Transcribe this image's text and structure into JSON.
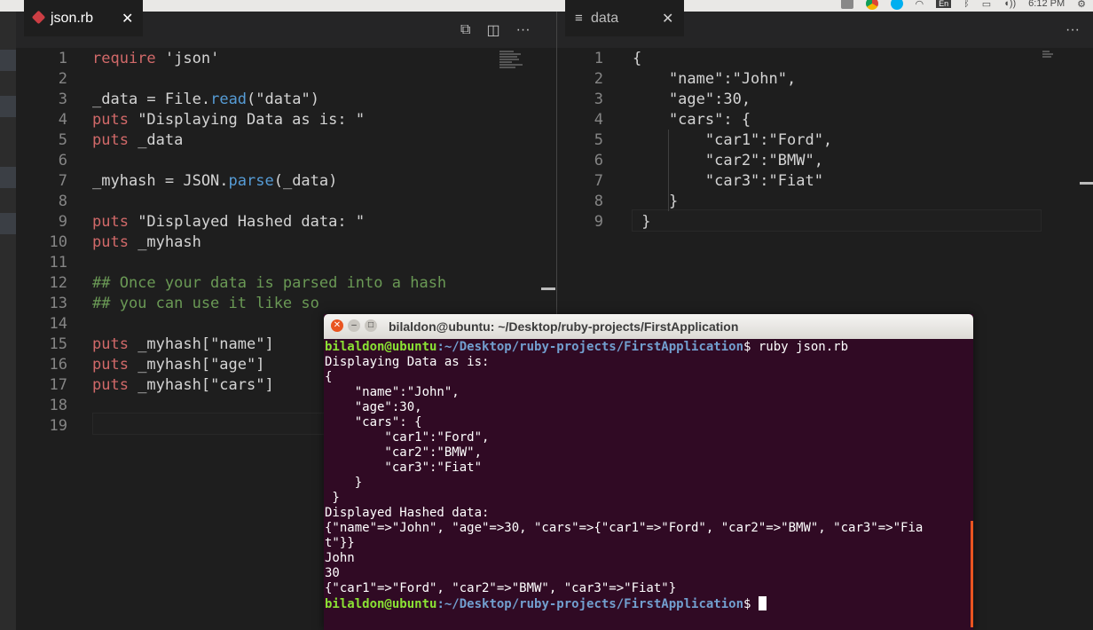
{
  "system_tray": {
    "keyboard_layout": "En",
    "clock": "6:12 PM",
    "icons": [
      "gamepad-icon",
      "chrome-icon",
      "skype-icon",
      "wifi-icon",
      "bluetooth-icon",
      "battery-icon",
      "volume-icon",
      "gear-icon"
    ]
  },
  "left_editor": {
    "tab": {
      "filename": "json.rb",
      "close": "✕"
    },
    "actions": {
      "open_preview": "⧉",
      "split": "◫",
      "more": "···"
    },
    "lines": [
      {
        "n": "1",
        "segments": [
          {
            "t": "require ",
            "c": "kw"
          },
          {
            "t": "'json'",
            "c": "str"
          }
        ]
      },
      {
        "n": "2",
        "segments": []
      },
      {
        "n": "3",
        "segments": [
          {
            "t": "_data = ",
            "c": ""
          },
          {
            "t": "File",
            "c": ""
          },
          {
            "t": ".",
            "c": ""
          },
          {
            "t": "read",
            "c": "meth"
          },
          {
            "t": "(\"data\")",
            "c": ""
          }
        ]
      },
      {
        "n": "4",
        "segments": [
          {
            "t": "puts ",
            "c": "kw"
          },
          {
            "t": "\"Displaying Data as is: \"",
            "c": "str"
          }
        ]
      },
      {
        "n": "5",
        "segments": [
          {
            "t": "puts ",
            "c": "kw"
          },
          {
            "t": "_data",
            "c": ""
          }
        ]
      },
      {
        "n": "6",
        "segments": []
      },
      {
        "n": "7",
        "segments": [
          {
            "t": "_myhash = JSON.",
            "c": ""
          },
          {
            "t": "parse",
            "c": "meth"
          },
          {
            "t": "(_data)",
            "c": ""
          }
        ]
      },
      {
        "n": "8",
        "segments": []
      },
      {
        "n": "9",
        "segments": [
          {
            "t": "puts ",
            "c": "kw"
          },
          {
            "t": "\"Displayed Hashed data: \"",
            "c": "str"
          }
        ]
      },
      {
        "n": "10",
        "segments": [
          {
            "t": "puts ",
            "c": "kw"
          },
          {
            "t": "_myhash",
            "c": ""
          }
        ]
      },
      {
        "n": "11",
        "segments": []
      },
      {
        "n": "12",
        "segments": [
          {
            "t": "## Once your data is parsed into a hash",
            "c": "cmt"
          }
        ]
      },
      {
        "n": "13",
        "segments": [
          {
            "t": "## you can use it like so",
            "c": "cmt"
          }
        ]
      },
      {
        "n": "14",
        "segments": []
      },
      {
        "n": "15",
        "segments": [
          {
            "t": "puts ",
            "c": "kw"
          },
          {
            "t": "_myhash[\"name\"]",
            "c": ""
          }
        ]
      },
      {
        "n": "16",
        "segments": [
          {
            "t": "puts ",
            "c": "kw"
          },
          {
            "t": "_myhash[\"age\"]",
            "c": ""
          }
        ]
      },
      {
        "n": "17",
        "segments": [
          {
            "t": "puts ",
            "c": "kw"
          },
          {
            "t": "_myhash[\"cars\"]",
            "c": ""
          }
        ]
      },
      {
        "n": "18",
        "segments": []
      },
      {
        "n": "19",
        "segments": []
      }
    ]
  },
  "right_editor": {
    "tab": {
      "filename": "data",
      "close": "✕"
    },
    "actions": {
      "more": "···"
    },
    "lines": [
      {
        "n": "1",
        "text": "{"
      },
      {
        "n": "2",
        "text": "    \"name\":\"John\","
      },
      {
        "n": "3",
        "text": "    \"age\":30,"
      },
      {
        "n": "4",
        "text": "    \"cars\": {"
      },
      {
        "n": "5",
        "text": "        \"car1\":\"Ford\","
      },
      {
        "n": "6",
        "text": "        \"car2\":\"BMW\","
      },
      {
        "n": "7",
        "text": "        \"car3\":\"Fiat\""
      },
      {
        "n": "8",
        "text": "    }"
      },
      {
        "n": "9",
        "text": " }"
      }
    ]
  },
  "terminal": {
    "title": "bilaldon@ubuntu: ~/Desktop/ruby-projects/FirstApplication",
    "prompt_user": "bilaldon@ubuntu",
    "prompt_path": ":~/Desktop/ruby-projects/FirstApplication",
    "prompt_end": "$ ",
    "command": "ruby json.rb",
    "output": [
      "Displaying Data as is:",
      "{",
      "    \"name\":\"John\",",
      "    \"age\":30,",
      "    \"cars\": {",
      "        \"car1\":\"Ford\",",
      "        \"car2\":\"BMW\",",
      "        \"car3\":\"Fiat\"",
      "    }",
      " }",
      "Displayed Hashed data:",
      "{\"name\"=>\"John\", \"age\"=>30, \"cars\"=>{\"car1\"=>\"Ford\", \"car2\"=>\"BMW\", \"car3\"=>\"Fia",
      "t\"}}",
      "John",
      "30",
      "{\"car1\"=>\"Ford\", \"car2\"=>\"BMW\", \"car3\"=>\"Fiat\"}"
    ]
  }
}
